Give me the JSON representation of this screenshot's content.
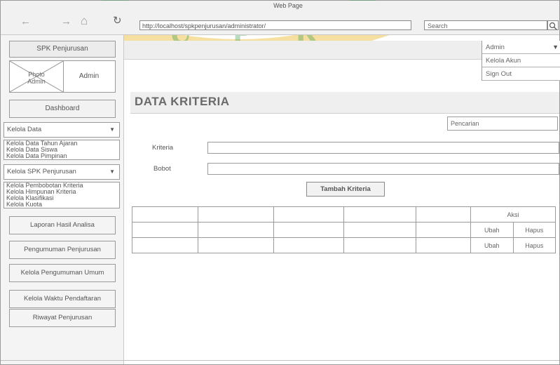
{
  "browser": {
    "window_title": "Web Page",
    "url": "http://localhost/spkpenjurusan/administrator/",
    "search_placeholder": "Search"
  },
  "sidebar": {
    "brand": "SPK Penjurusan",
    "photo_label": "Photo\nAdmin",
    "admin_name": "Admin",
    "dashboard": "Dashboard",
    "kelola_data": {
      "label": "Kelola Data",
      "items": [
        "Kelola Data Tahun Ajaran",
        "Kelola Data Siswa",
        "Kelola Data Pimpinan"
      ]
    },
    "kelola_spk": {
      "label": "Kelola SPK Penjurusan",
      "items": [
        "Kelola Pembobotan Kriteria",
        "Kelola Himpunan Kriteria",
        "Kelola Klasifikasi",
        "Kelola Kuota"
      ]
    },
    "menu": [
      "Laporan Hasil Analisa",
      "Pengumuman Penjurusan",
      "Kelola Pengumuman Umum",
      "Kelola Waktu Pendaftaran",
      "Riwayat Penjurusan"
    ]
  },
  "admin_menu": {
    "label": "Admin",
    "items": [
      "Kelola Akun",
      "Sign Out"
    ]
  },
  "main": {
    "title": "DATA KRITERIA",
    "search_placeholder": "Pencarian",
    "fields": {
      "kriteria_label": "Kriteria",
      "bobot_label": "Bobot"
    },
    "add_button": "Tambah Kriteria",
    "table": {
      "aksi_header": "Aksi",
      "rows": [
        {
          "edit": "Ubah",
          "delete": "Hapus"
        },
        {
          "edit": "Ubah",
          "delete": "Hapus"
        }
      ]
    }
  },
  "colors": {
    "watermark": "#e8b82e",
    "watermark_green": "#3a9a4a"
  }
}
